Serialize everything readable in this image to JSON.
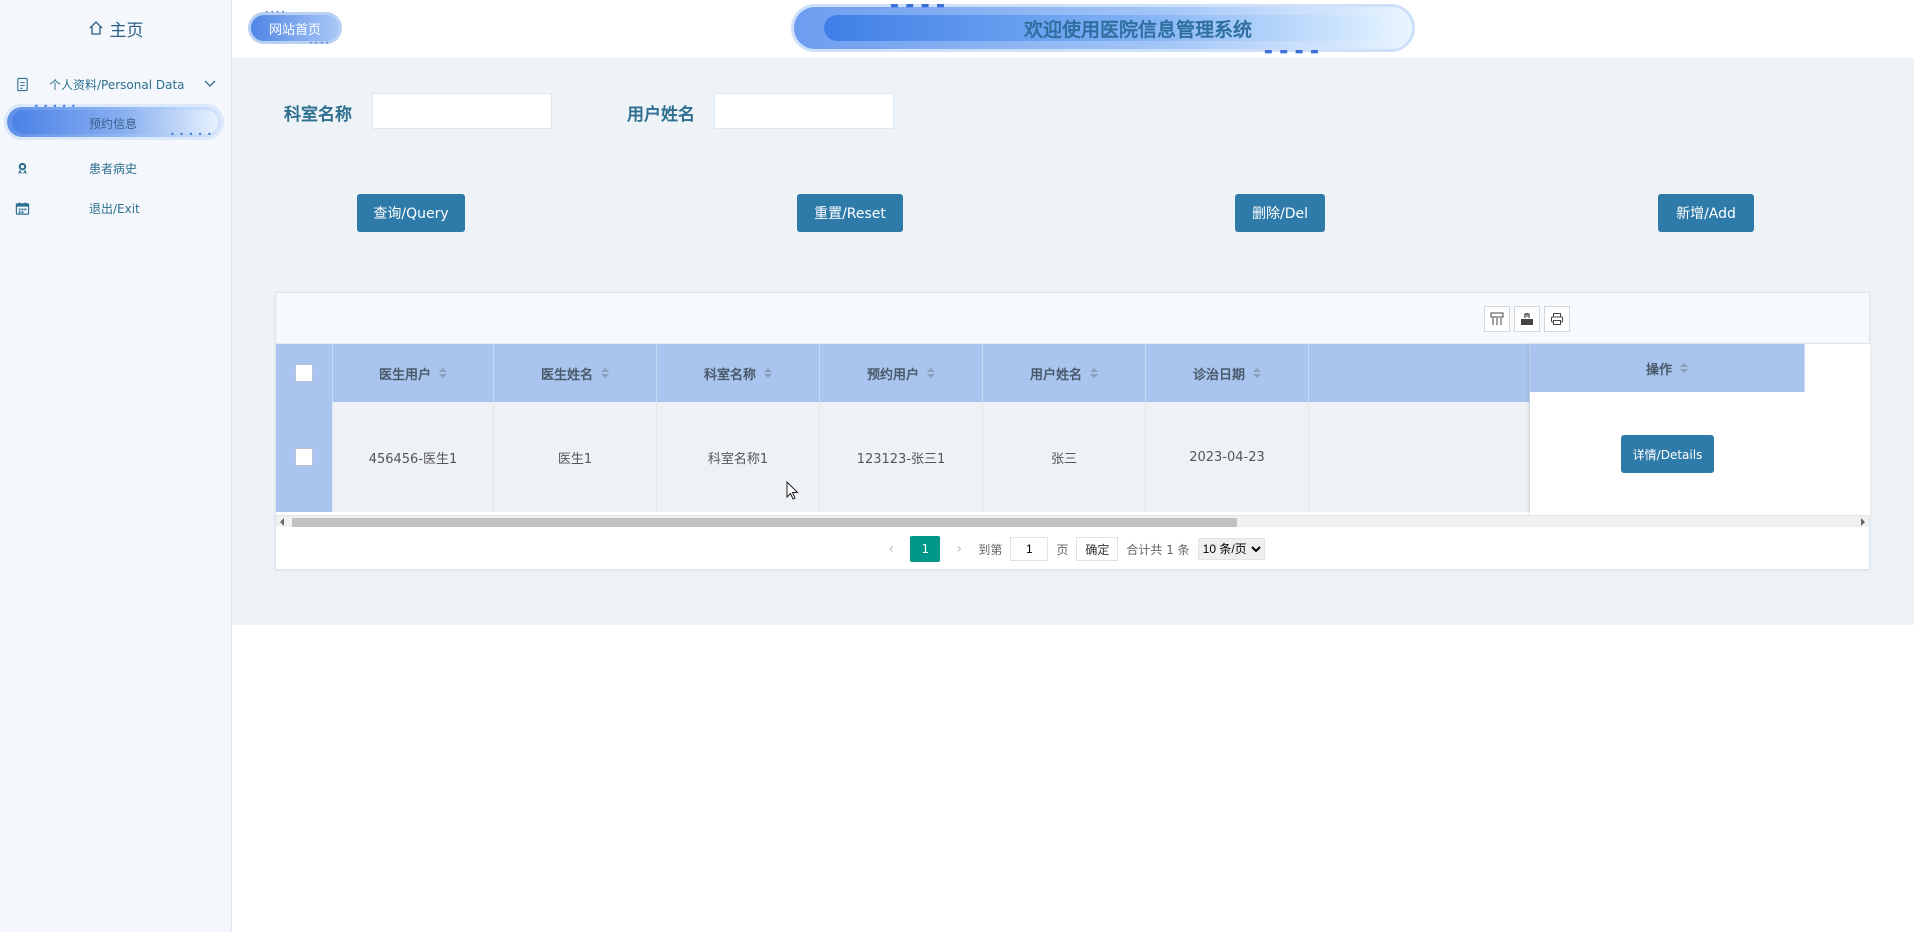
{
  "sidebar": {
    "home_label": "主页",
    "items": [
      {
        "label": "个人资料/Personal Data",
        "icon": "document-icon"
      },
      {
        "label": "预约信息",
        "icon": ""
      },
      {
        "label": "患者病史",
        "icon": "award-icon"
      },
      {
        "label": "退出/Exit",
        "icon": "calendar-icon"
      }
    ]
  },
  "header": {
    "site_home": "网站首页",
    "title": "欢迎使用医院信息管理系统"
  },
  "filters": {
    "dept_label": "科室名称",
    "dept_value": "",
    "user_label": "用户姓名",
    "user_value": ""
  },
  "actions": {
    "query": "查询/Query",
    "reset": "重置/Reset",
    "delete": "删除/Del",
    "add": "新增/Add"
  },
  "table": {
    "columns": [
      "医生用户",
      "医生姓名",
      "科室名称",
      "预约用户",
      "用户姓名",
      "诊治日期",
      "操作"
    ],
    "rows": [
      {
        "doctor_user": "456456-医生1",
        "doctor_name": "医生1",
        "dept": "科室名称1",
        "appt_user": "123123-张三1",
        "user_name": "张三",
        "date": "2023-04-23",
        "action": "详情/Details"
      }
    ]
  },
  "pager": {
    "current": "1",
    "goto_label": "到第",
    "goto_value": "1",
    "page_unit": "页",
    "confirm": "确定",
    "total": "合计共 1 条",
    "page_size": "10 条/页"
  },
  "colors": {
    "primary_button": "#2e7aa9",
    "header_row": "#a9c5ef",
    "current_page": "#009688",
    "label_text": "#2f6f8f"
  }
}
